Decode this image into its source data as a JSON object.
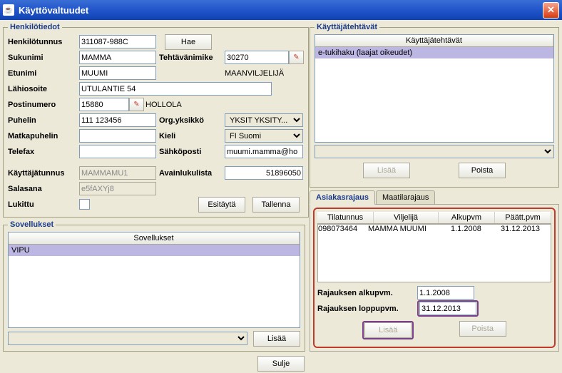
{
  "window_title": "Käyttövaltuudet",
  "personal": {
    "legend": "Henkilötiedot",
    "ssn_label": "Henkilötunnus",
    "ssn_value": "311087-988C",
    "fetch_label": "Hae",
    "lastname_label": "Sukunimi",
    "lastname_value": "MAMMA",
    "jobtitle_label": "Tehtävänimike",
    "jobtitle_value": "30270",
    "firstname_label": "Etunimi",
    "firstname_value": "MUUMI",
    "occupation_value": "MAANVILJELIJÄ",
    "address_label": "Lähiosoite",
    "address_value": "UTULANTIE 54",
    "postcode_label": "Postinumero",
    "postcode_value": "15880",
    "city_value": "HOLLOLA",
    "phone_label": "Puhelin",
    "phone_value": "111 123456",
    "orgunit_label": "Org.yksikkö",
    "orgunit_value": "YKSIT  YKSITY...",
    "mobile_label": "Matkapuhelin",
    "mobile_value": "",
    "lang_label": "Kieli",
    "lang_value": "FI  Suomi",
    "fax_label": "Telefax",
    "fax_value": "",
    "email_label": "Sähköposti",
    "email_value": "muumi.mamma@ho",
    "username_label": "Käyttäjätunnus",
    "username_value": "MAMMAMU1",
    "keylist_label": "Avainlukulista",
    "keylist_value": "51896050",
    "password_label": "Salasana",
    "password_value": "e5fAXYj8",
    "locked_label": "Lukittu",
    "prefill_label": "Esitäytä",
    "save_label": "Tallenna"
  },
  "apps": {
    "legend": "Sovellukset",
    "col": "Sovellukset",
    "rows": [
      "VIPU"
    ],
    "add_label": "Lisää"
  },
  "tasks": {
    "legend": "Käyttäjätehtävät",
    "col": "Käyttäjätehtävät",
    "rows": [
      "e-tukihaku (laajat oikeudet)"
    ],
    "add_label": "Lisää",
    "delete_label": "Poista"
  },
  "tabs": {
    "customer": "Asiakasrajaus",
    "farm": "Maatilarajaus"
  },
  "customer": {
    "cols": {
      "farmid": "Tilatunnus",
      "farmer": "Viljelijä",
      "start": "Alkupvm",
      "end": "Päätt.pvm"
    },
    "row": {
      "farmid": "098073464",
      "farmer": "MAMMA MUUMI",
      "start": "1.1.2008",
      "end": "31.12.2013"
    },
    "start_label": "Rajauksen alkupvm.",
    "start_value": "1.1.2008",
    "end_label": "Rajauksen loppupvm.",
    "end_value": "31.12.2013",
    "add_label": "Lisää",
    "delete_label": "Poista"
  },
  "close_label": "Sulje"
}
